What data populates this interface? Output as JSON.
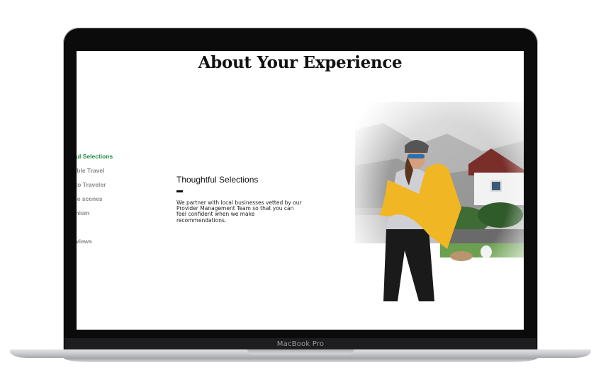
{
  "page": {
    "title": "About Your Experience"
  },
  "side_nav": {
    "items": [
      {
        "label": "htful Selections",
        "active": true
      },
      {
        "label": "nsible Travel",
        "active": false
      },
      {
        "label": "er to Traveler",
        "active": false
      },
      {
        "label": "l the scenes",
        "active": false
      },
      {
        "label": "tionism",
        "active": false
      },
      {
        "label": "Reviews",
        "active": false
      }
    ]
  },
  "content": {
    "heading": "Thoughtful Selections",
    "body": "We partner with local businesses vetted by our Provider Management Team so that you can feel confident when we make recommendations."
  },
  "device": {
    "brand": "MacBook Pro"
  },
  "colors": {
    "active_nav": "#1e8a3e",
    "inactive_nav": "#8a8a8a",
    "bezel": "#0b0b0b"
  }
}
